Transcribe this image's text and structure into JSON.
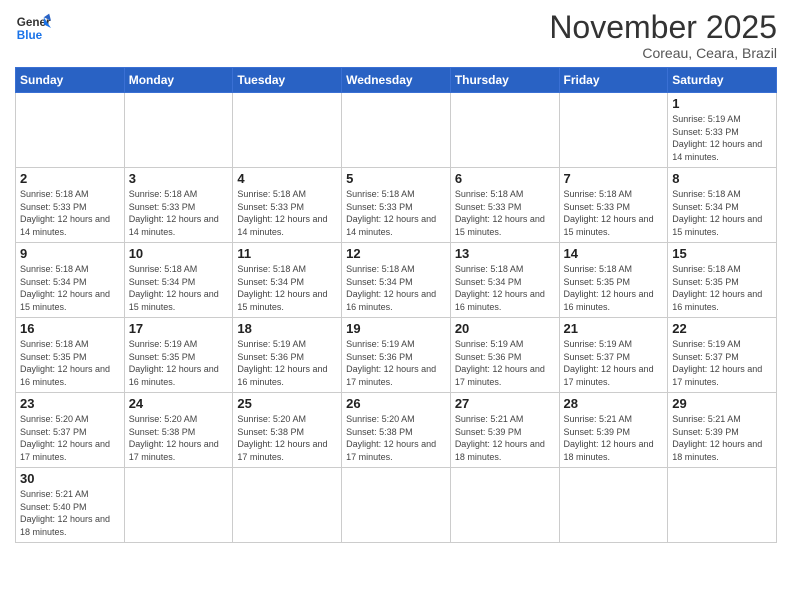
{
  "logo": {
    "text_general": "General",
    "text_blue": "Blue"
  },
  "header": {
    "title": "November 2025",
    "subtitle": "Coreau, Ceara, Brazil"
  },
  "weekdays": [
    "Sunday",
    "Monday",
    "Tuesday",
    "Wednesday",
    "Thursday",
    "Friday",
    "Saturday"
  ],
  "weeks": [
    [
      {
        "day": "",
        "info": ""
      },
      {
        "day": "",
        "info": ""
      },
      {
        "day": "",
        "info": ""
      },
      {
        "day": "",
        "info": ""
      },
      {
        "day": "",
        "info": ""
      },
      {
        "day": "",
        "info": ""
      },
      {
        "day": "1",
        "info": "Sunrise: 5:19 AM\nSunset: 5:33 PM\nDaylight: 12 hours and 14 minutes."
      }
    ],
    [
      {
        "day": "2",
        "info": "Sunrise: 5:18 AM\nSunset: 5:33 PM\nDaylight: 12 hours and 14 minutes."
      },
      {
        "day": "3",
        "info": "Sunrise: 5:18 AM\nSunset: 5:33 PM\nDaylight: 12 hours and 14 minutes."
      },
      {
        "day": "4",
        "info": "Sunrise: 5:18 AM\nSunset: 5:33 PM\nDaylight: 12 hours and 14 minutes."
      },
      {
        "day": "5",
        "info": "Sunrise: 5:18 AM\nSunset: 5:33 PM\nDaylight: 12 hours and 14 minutes."
      },
      {
        "day": "6",
        "info": "Sunrise: 5:18 AM\nSunset: 5:33 PM\nDaylight: 12 hours and 15 minutes."
      },
      {
        "day": "7",
        "info": "Sunrise: 5:18 AM\nSunset: 5:33 PM\nDaylight: 12 hours and 15 minutes."
      },
      {
        "day": "8",
        "info": "Sunrise: 5:18 AM\nSunset: 5:34 PM\nDaylight: 12 hours and 15 minutes."
      }
    ],
    [
      {
        "day": "9",
        "info": "Sunrise: 5:18 AM\nSunset: 5:34 PM\nDaylight: 12 hours and 15 minutes."
      },
      {
        "day": "10",
        "info": "Sunrise: 5:18 AM\nSunset: 5:34 PM\nDaylight: 12 hours and 15 minutes."
      },
      {
        "day": "11",
        "info": "Sunrise: 5:18 AM\nSunset: 5:34 PM\nDaylight: 12 hours and 15 minutes."
      },
      {
        "day": "12",
        "info": "Sunrise: 5:18 AM\nSunset: 5:34 PM\nDaylight: 12 hours and 16 minutes."
      },
      {
        "day": "13",
        "info": "Sunrise: 5:18 AM\nSunset: 5:34 PM\nDaylight: 12 hours and 16 minutes."
      },
      {
        "day": "14",
        "info": "Sunrise: 5:18 AM\nSunset: 5:35 PM\nDaylight: 12 hours and 16 minutes."
      },
      {
        "day": "15",
        "info": "Sunrise: 5:18 AM\nSunset: 5:35 PM\nDaylight: 12 hours and 16 minutes."
      }
    ],
    [
      {
        "day": "16",
        "info": "Sunrise: 5:18 AM\nSunset: 5:35 PM\nDaylight: 12 hours and 16 minutes."
      },
      {
        "day": "17",
        "info": "Sunrise: 5:19 AM\nSunset: 5:35 PM\nDaylight: 12 hours and 16 minutes."
      },
      {
        "day": "18",
        "info": "Sunrise: 5:19 AM\nSunset: 5:36 PM\nDaylight: 12 hours and 16 minutes."
      },
      {
        "day": "19",
        "info": "Sunrise: 5:19 AM\nSunset: 5:36 PM\nDaylight: 12 hours and 17 minutes."
      },
      {
        "day": "20",
        "info": "Sunrise: 5:19 AM\nSunset: 5:36 PM\nDaylight: 12 hours and 17 minutes."
      },
      {
        "day": "21",
        "info": "Sunrise: 5:19 AM\nSunset: 5:37 PM\nDaylight: 12 hours and 17 minutes."
      },
      {
        "day": "22",
        "info": "Sunrise: 5:19 AM\nSunset: 5:37 PM\nDaylight: 12 hours and 17 minutes."
      }
    ],
    [
      {
        "day": "23",
        "info": "Sunrise: 5:20 AM\nSunset: 5:37 PM\nDaylight: 12 hours and 17 minutes."
      },
      {
        "day": "24",
        "info": "Sunrise: 5:20 AM\nSunset: 5:38 PM\nDaylight: 12 hours and 17 minutes."
      },
      {
        "day": "25",
        "info": "Sunrise: 5:20 AM\nSunset: 5:38 PM\nDaylight: 12 hours and 17 minutes."
      },
      {
        "day": "26",
        "info": "Sunrise: 5:20 AM\nSunset: 5:38 PM\nDaylight: 12 hours and 17 minutes."
      },
      {
        "day": "27",
        "info": "Sunrise: 5:21 AM\nSunset: 5:39 PM\nDaylight: 12 hours and 18 minutes."
      },
      {
        "day": "28",
        "info": "Sunrise: 5:21 AM\nSunset: 5:39 PM\nDaylight: 12 hours and 18 minutes."
      },
      {
        "day": "29",
        "info": "Sunrise: 5:21 AM\nSunset: 5:39 PM\nDaylight: 12 hours and 18 minutes."
      }
    ],
    [
      {
        "day": "30",
        "info": "Sunrise: 5:21 AM\nSunset: 5:40 PM\nDaylight: 12 hours and 18 minutes."
      },
      {
        "day": "",
        "info": ""
      },
      {
        "day": "",
        "info": ""
      },
      {
        "day": "",
        "info": ""
      },
      {
        "day": "",
        "info": ""
      },
      {
        "day": "",
        "info": ""
      },
      {
        "day": "",
        "info": ""
      }
    ]
  ]
}
